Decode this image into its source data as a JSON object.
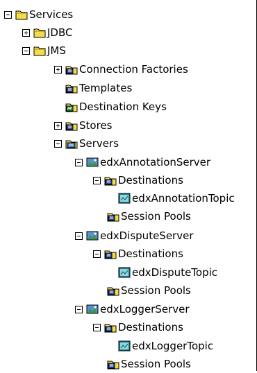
{
  "tree": [
    {
      "label": "Services",
      "icon": "folder-icon",
      "toggle": "minus"
    },
    {
      "label": "JDBC",
      "icon": "folder-icon",
      "toggle": "plus"
    },
    {
      "label": "JMS",
      "icon": "folder-icon",
      "toggle": "minus"
    },
    {
      "label": "Connection Factories",
      "icon": "connection-factory-icon",
      "toggle": "plus"
    },
    {
      "label": "Templates",
      "icon": "template-icon",
      "toggle": "none"
    },
    {
      "label": "Destination Keys",
      "icon": "destination-key-icon",
      "toggle": "none"
    },
    {
      "label": "Stores",
      "icon": "store-icon",
      "toggle": "plus"
    },
    {
      "label": "Servers",
      "icon": "servers-icon",
      "toggle": "minus"
    },
    {
      "label": "edxAnnotationServer",
      "icon": "server-icon",
      "toggle": "minus"
    },
    {
      "label": "Destinations",
      "icon": "destinations-icon",
      "toggle": "minus"
    },
    {
      "label": "edxAnnotationTopic",
      "icon": "topic-icon",
      "toggle": "none"
    },
    {
      "label": "Session Pools",
      "icon": "session-pool-icon",
      "toggle": "none"
    },
    {
      "label": "edxDisputeServer",
      "icon": "server-icon",
      "toggle": "minus"
    },
    {
      "label": "Destinations",
      "icon": "destinations-icon",
      "toggle": "minus"
    },
    {
      "label": "edxDisputeTopic",
      "icon": "topic-icon",
      "toggle": "none"
    },
    {
      "label": "Session Pools",
      "icon": "session-pool-icon",
      "toggle": "none"
    },
    {
      "label": "edxLoggerServer",
      "icon": "server-icon",
      "toggle": "minus"
    },
    {
      "label": "Destinations",
      "icon": "destinations-icon",
      "toggle": "minus"
    },
    {
      "label": "edxLoggerTopic",
      "icon": "topic-icon",
      "toggle": "none"
    },
    {
      "label": "Session Pools",
      "icon": "session-pool-icon",
      "toggle": "none"
    }
  ]
}
